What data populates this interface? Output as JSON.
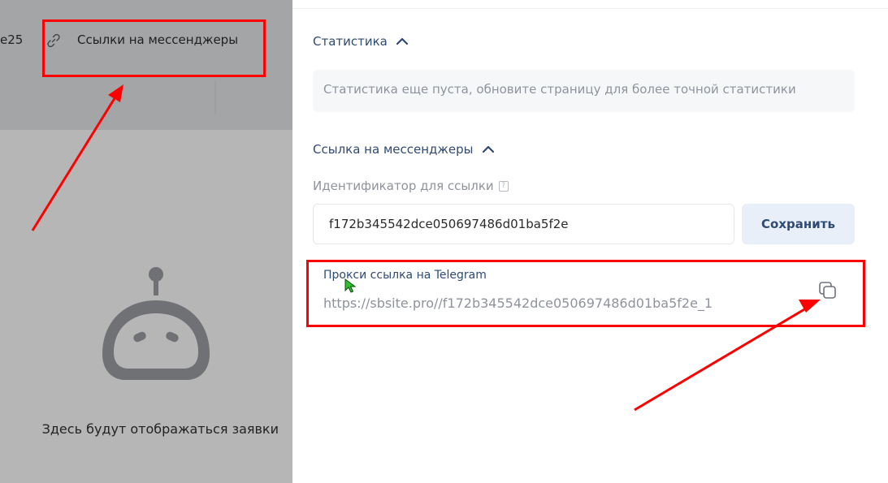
{
  "left_panel": {
    "workspace_name": "e25",
    "link_item_label": "Ссылки на мессенджеры",
    "empty_text": "Здесь будут отображаться заявки",
    "icons": {
      "link": "link-icon",
      "robot": "robot-illustration"
    }
  },
  "statistics": {
    "title": "Статистика",
    "empty_message": "Статистика еще пуста, обновите страницу для более точной статистики"
  },
  "messenger_link": {
    "title": "Ссылка на мессенджеры",
    "identifier_label": "Идентификатор для ссылки",
    "identifier_value": "f172b345542dce050697486d01ba5f2e",
    "save_label": "Сохранить",
    "proxy_label": "Прокси ссылка на Telegram",
    "proxy_url": "https://sbsite.pro//f172b345542dce050697486d01ba5f2e_1"
  },
  "colors": {
    "accent": "#2f4a73",
    "overlay": "#b6b6b7",
    "annotation": "#ff0000"
  }
}
